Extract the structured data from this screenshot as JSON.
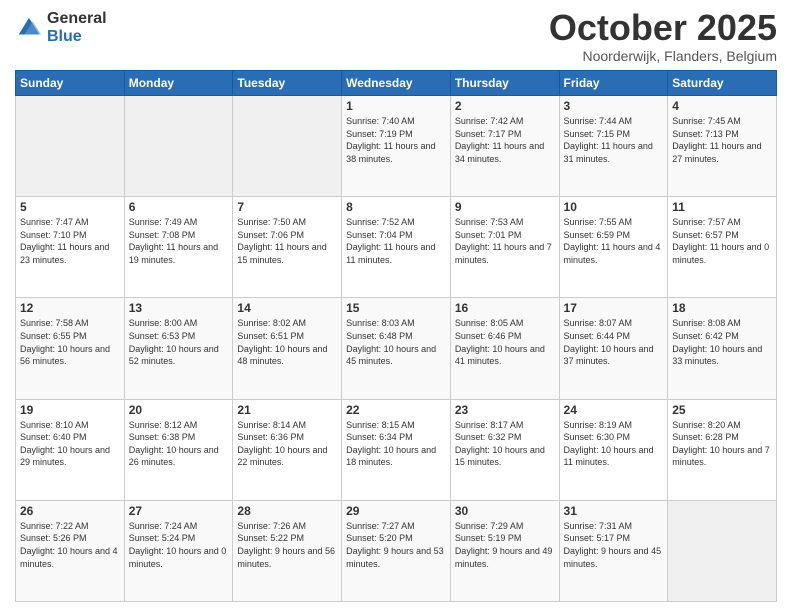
{
  "header": {
    "logo_general": "General",
    "logo_blue": "Blue",
    "month_title": "October 2025",
    "location": "Noorderwijk, Flanders, Belgium"
  },
  "days_of_week": [
    "Sunday",
    "Monday",
    "Tuesday",
    "Wednesday",
    "Thursday",
    "Friday",
    "Saturday"
  ],
  "weeks": [
    [
      {
        "day": "",
        "sunrise": "",
        "sunset": "",
        "daylight": ""
      },
      {
        "day": "",
        "sunrise": "",
        "sunset": "",
        "daylight": ""
      },
      {
        "day": "",
        "sunrise": "",
        "sunset": "",
        "daylight": ""
      },
      {
        "day": "1",
        "sunrise": "Sunrise: 7:40 AM",
        "sunset": "Sunset: 7:19 PM",
        "daylight": "Daylight: 11 hours and 38 minutes."
      },
      {
        "day": "2",
        "sunrise": "Sunrise: 7:42 AM",
        "sunset": "Sunset: 7:17 PM",
        "daylight": "Daylight: 11 hours and 34 minutes."
      },
      {
        "day": "3",
        "sunrise": "Sunrise: 7:44 AM",
        "sunset": "Sunset: 7:15 PM",
        "daylight": "Daylight: 11 hours and 31 minutes."
      },
      {
        "day": "4",
        "sunrise": "Sunrise: 7:45 AM",
        "sunset": "Sunset: 7:13 PM",
        "daylight": "Daylight: 11 hours and 27 minutes."
      }
    ],
    [
      {
        "day": "5",
        "sunrise": "Sunrise: 7:47 AM",
        "sunset": "Sunset: 7:10 PM",
        "daylight": "Daylight: 11 hours and 23 minutes."
      },
      {
        "day": "6",
        "sunrise": "Sunrise: 7:49 AM",
        "sunset": "Sunset: 7:08 PM",
        "daylight": "Daylight: 11 hours and 19 minutes."
      },
      {
        "day": "7",
        "sunrise": "Sunrise: 7:50 AM",
        "sunset": "Sunset: 7:06 PM",
        "daylight": "Daylight: 11 hours and 15 minutes."
      },
      {
        "day": "8",
        "sunrise": "Sunrise: 7:52 AM",
        "sunset": "Sunset: 7:04 PM",
        "daylight": "Daylight: 11 hours and 11 minutes."
      },
      {
        "day": "9",
        "sunrise": "Sunrise: 7:53 AM",
        "sunset": "Sunset: 7:01 PM",
        "daylight": "Daylight: 11 hours and 7 minutes."
      },
      {
        "day": "10",
        "sunrise": "Sunrise: 7:55 AM",
        "sunset": "Sunset: 6:59 PM",
        "daylight": "Daylight: 11 hours and 4 minutes."
      },
      {
        "day": "11",
        "sunrise": "Sunrise: 7:57 AM",
        "sunset": "Sunset: 6:57 PM",
        "daylight": "Daylight: 11 hours and 0 minutes."
      }
    ],
    [
      {
        "day": "12",
        "sunrise": "Sunrise: 7:58 AM",
        "sunset": "Sunset: 6:55 PM",
        "daylight": "Daylight: 10 hours and 56 minutes."
      },
      {
        "day": "13",
        "sunrise": "Sunrise: 8:00 AM",
        "sunset": "Sunset: 6:53 PM",
        "daylight": "Daylight: 10 hours and 52 minutes."
      },
      {
        "day": "14",
        "sunrise": "Sunrise: 8:02 AM",
        "sunset": "Sunset: 6:51 PM",
        "daylight": "Daylight: 10 hours and 48 minutes."
      },
      {
        "day": "15",
        "sunrise": "Sunrise: 8:03 AM",
        "sunset": "Sunset: 6:48 PM",
        "daylight": "Daylight: 10 hours and 45 minutes."
      },
      {
        "day": "16",
        "sunrise": "Sunrise: 8:05 AM",
        "sunset": "Sunset: 6:46 PM",
        "daylight": "Daylight: 10 hours and 41 minutes."
      },
      {
        "day": "17",
        "sunrise": "Sunrise: 8:07 AM",
        "sunset": "Sunset: 6:44 PM",
        "daylight": "Daylight: 10 hours and 37 minutes."
      },
      {
        "day": "18",
        "sunrise": "Sunrise: 8:08 AM",
        "sunset": "Sunset: 6:42 PM",
        "daylight": "Daylight: 10 hours and 33 minutes."
      }
    ],
    [
      {
        "day": "19",
        "sunrise": "Sunrise: 8:10 AM",
        "sunset": "Sunset: 6:40 PM",
        "daylight": "Daylight: 10 hours and 29 minutes."
      },
      {
        "day": "20",
        "sunrise": "Sunrise: 8:12 AM",
        "sunset": "Sunset: 6:38 PM",
        "daylight": "Daylight: 10 hours and 26 minutes."
      },
      {
        "day": "21",
        "sunrise": "Sunrise: 8:14 AM",
        "sunset": "Sunset: 6:36 PM",
        "daylight": "Daylight: 10 hours and 22 minutes."
      },
      {
        "day": "22",
        "sunrise": "Sunrise: 8:15 AM",
        "sunset": "Sunset: 6:34 PM",
        "daylight": "Daylight: 10 hours and 18 minutes."
      },
      {
        "day": "23",
        "sunrise": "Sunrise: 8:17 AM",
        "sunset": "Sunset: 6:32 PM",
        "daylight": "Daylight: 10 hours and 15 minutes."
      },
      {
        "day": "24",
        "sunrise": "Sunrise: 8:19 AM",
        "sunset": "Sunset: 6:30 PM",
        "daylight": "Daylight: 10 hours and 11 minutes."
      },
      {
        "day": "25",
        "sunrise": "Sunrise: 8:20 AM",
        "sunset": "Sunset: 6:28 PM",
        "daylight": "Daylight: 10 hours and 7 minutes."
      }
    ],
    [
      {
        "day": "26",
        "sunrise": "Sunrise: 7:22 AM",
        "sunset": "Sunset: 5:26 PM",
        "daylight": "Daylight: 10 hours and 4 minutes."
      },
      {
        "day": "27",
        "sunrise": "Sunrise: 7:24 AM",
        "sunset": "Sunset: 5:24 PM",
        "daylight": "Daylight: 10 hours and 0 minutes."
      },
      {
        "day": "28",
        "sunrise": "Sunrise: 7:26 AM",
        "sunset": "Sunset: 5:22 PM",
        "daylight": "Daylight: 9 hours and 56 minutes."
      },
      {
        "day": "29",
        "sunrise": "Sunrise: 7:27 AM",
        "sunset": "Sunset: 5:20 PM",
        "daylight": "Daylight: 9 hours and 53 minutes."
      },
      {
        "day": "30",
        "sunrise": "Sunrise: 7:29 AM",
        "sunset": "Sunset: 5:19 PM",
        "daylight": "Daylight: 9 hours and 49 minutes."
      },
      {
        "day": "31",
        "sunrise": "Sunrise: 7:31 AM",
        "sunset": "Sunset: 5:17 PM",
        "daylight": "Daylight: 9 hours and 45 minutes."
      },
      {
        "day": "",
        "sunrise": "",
        "sunset": "",
        "daylight": ""
      }
    ]
  ]
}
